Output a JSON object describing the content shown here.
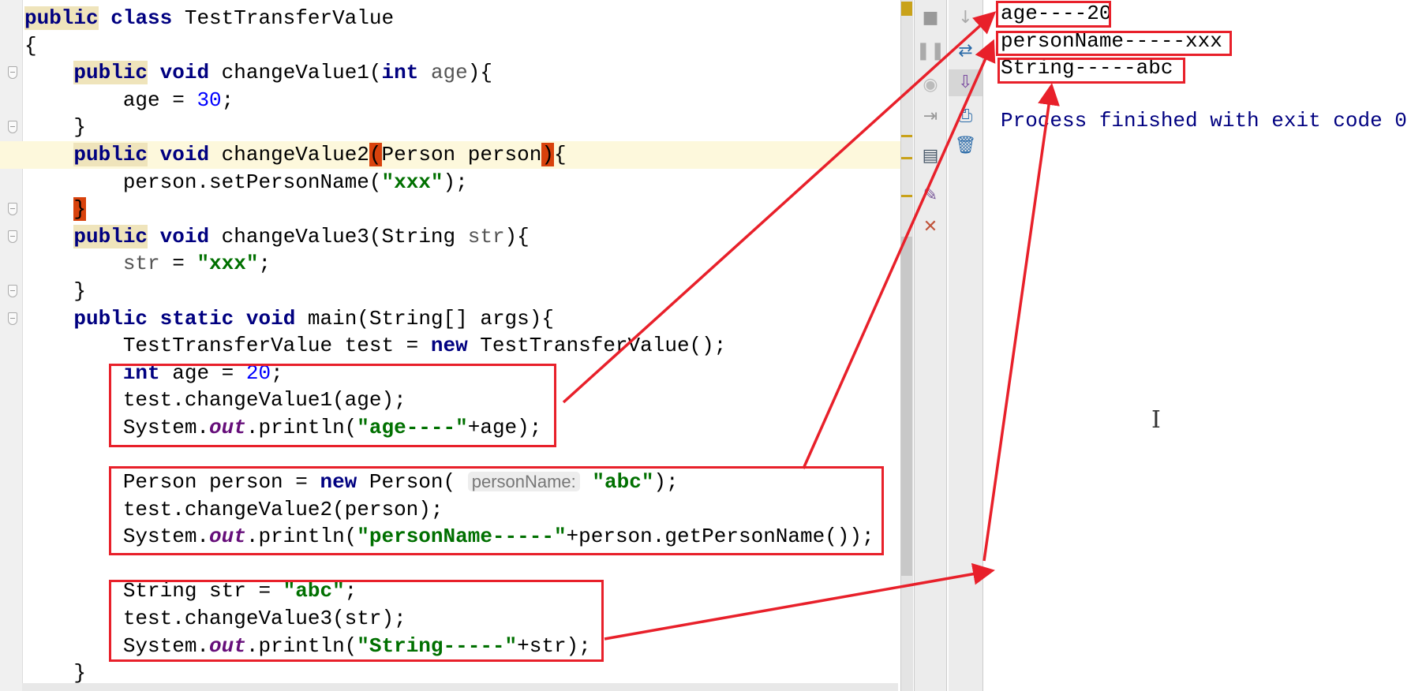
{
  "editor": {
    "current_line": 5,
    "lines": [
      [
        [
          "pub",
          "public"
        ],
        [
          "t",
          " "
        ],
        [
          "k",
          "class"
        ],
        [
          "t",
          " TestTransferValue"
        ]
      ],
      [
        [
          "t",
          "{"
        ]
      ],
      [
        [
          "t",
          "    "
        ],
        [
          "pub",
          "public"
        ],
        [
          "t",
          " "
        ],
        [
          "k",
          "void"
        ],
        [
          "t",
          " changeValue1("
        ],
        [
          "k",
          "int"
        ],
        [
          "t",
          " "
        ],
        [
          "p",
          "age"
        ],
        [
          "t",
          "){"
        ]
      ],
      [
        [
          "t",
          "        age = "
        ],
        [
          "n",
          "30"
        ],
        [
          "t",
          ";"
        ]
      ],
      [
        [
          "t",
          "    }"
        ]
      ],
      [
        [
          "t",
          "    "
        ],
        [
          "pub",
          "public"
        ],
        [
          "t",
          " "
        ],
        [
          "k",
          "void"
        ],
        [
          "t",
          " changeValue2"
        ],
        [
          "bh",
          "("
        ],
        [
          "t",
          "Person person"
        ],
        [
          "bh",
          ")"
        ],
        [
          "t",
          "{"
        ]
      ],
      [
        [
          "t",
          "        person.setPersonName("
        ],
        [
          "s",
          "\"xxx\""
        ],
        [
          "t",
          ");"
        ]
      ],
      [
        [
          "t",
          "    "
        ],
        [
          "bh",
          "}"
        ]
      ],
      [
        [
          "t",
          "    "
        ],
        [
          "pub",
          "public"
        ],
        [
          "t",
          " "
        ],
        [
          "k",
          "void"
        ],
        [
          "t",
          " changeValue3(String "
        ],
        [
          "p",
          "str"
        ],
        [
          "t",
          "){"
        ]
      ],
      [
        [
          "t",
          "        "
        ],
        [
          "p",
          "str"
        ],
        [
          "t",
          " = "
        ],
        [
          "s",
          "\"xxx\""
        ],
        [
          "t",
          ";"
        ]
      ],
      [
        [
          "t",
          "    }"
        ]
      ],
      [
        [
          "t",
          "    "
        ],
        [
          "k",
          "public"
        ],
        [
          "t",
          " "
        ],
        [
          "k",
          "static"
        ],
        [
          "t",
          " "
        ],
        [
          "k",
          "void"
        ],
        [
          "t",
          " main(String[] args){"
        ]
      ],
      [
        [
          "t",
          "        TestTransferValue test = "
        ],
        [
          "k",
          "new"
        ],
        [
          "t",
          " TestTransferValue();"
        ]
      ],
      [
        [
          "t",
          "        "
        ],
        [
          "k",
          "int"
        ],
        [
          "t",
          " age = "
        ],
        [
          "n",
          "20"
        ],
        [
          "t",
          ";"
        ]
      ],
      [
        [
          "t",
          "        test.changeValue1(age);"
        ]
      ],
      [
        [
          "t",
          "        System."
        ],
        [
          "o",
          "out"
        ],
        [
          "t",
          ".println("
        ],
        [
          "s",
          "\"age----\""
        ],
        [
          "t",
          "+age);"
        ]
      ],
      [
        [
          "t",
          ""
        ]
      ],
      [
        [
          "t",
          "        Person person = "
        ],
        [
          "k",
          "new"
        ],
        [
          "t",
          " Person( "
        ],
        [
          "h",
          "personName:"
        ],
        [
          "t",
          " "
        ],
        [
          "s",
          "\"abc\""
        ],
        [
          "t",
          ");"
        ]
      ],
      [
        [
          "t",
          "        test.changeValue2(person);"
        ]
      ],
      [
        [
          "t",
          "        System."
        ],
        [
          "o",
          "out"
        ],
        [
          "t",
          ".println("
        ],
        [
          "s",
          "\"personName-----\""
        ],
        [
          "t",
          "+person.getPersonName());"
        ]
      ],
      [
        [
          "t",
          ""
        ]
      ],
      [
        [
          "t",
          "        String str = "
        ],
        [
          "s",
          "\"abc\""
        ],
        [
          "t",
          ";"
        ]
      ],
      [
        [
          "t",
          "        test.changeValue3(str);"
        ]
      ],
      [
        [
          "t",
          "        System."
        ],
        [
          "o",
          "out"
        ],
        [
          "t",
          ".println("
        ],
        [
          "s",
          "\"String-----\""
        ],
        [
          "t",
          "+str);"
        ]
      ],
      [
        [
          "t",
          "    }"
        ]
      ]
    ]
  },
  "toolbar_left": [
    "stop-icon",
    "pause-icon",
    "camera-icon",
    "login-icon",
    "layout-icon",
    "pin-icon",
    "close-icon"
  ],
  "toolbar_right": [
    "scroll-down-icon",
    "soft-wrap-icon",
    "scroll-to-end-icon",
    "print-icon",
    "trash-icon"
  ],
  "console": {
    "lines": [
      "age----20",
      "personName-----xxx",
      "String-----abc",
      "",
      "Process finished with exit code 0"
    ],
    "process_color": "#000080"
  },
  "annotation_color": "#e8202a"
}
